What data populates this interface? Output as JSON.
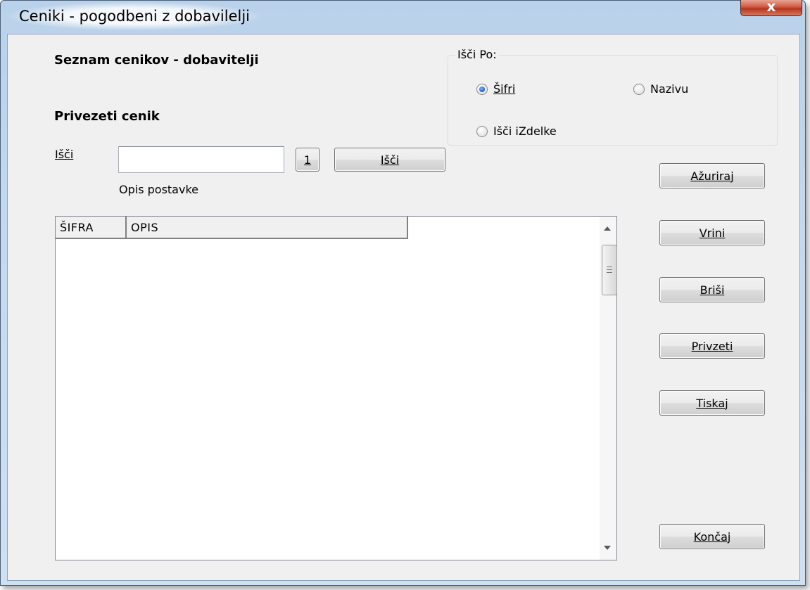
{
  "window": {
    "title": "Ceniki - pogodbeni z dobavilelji",
    "close_label": "x"
  },
  "form": {
    "heading": "Seznam cenikov - dobavitelji",
    "subheading": "Privezeti cenik",
    "search_label": "Išči",
    "search_value": "",
    "search_hint": "Opis postavke",
    "number_button_label": "1",
    "search_button_label": "Išči"
  },
  "search_by": {
    "title": "Išči Po:",
    "options": [
      {
        "label": "Šifri",
        "checked": true
      },
      {
        "label": "Nazivu",
        "checked": false
      },
      {
        "label": "Išči iZdelke",
        "checked": false
      }
    ]
  },
  "grid": {
    "columns": [
      "ŠIFRA",
      "OPIS"
    ],
    "rows": []
  },
  "buttons": {
    "update": "Ažuriraj",
    "insert": "Vrini",
    "delete": "Briši",
    "adopt": "Privzeti",
    "print": "Tiskaj",
    "finish": "Končaj"
  },
  "colors": {
    "window_frame": "#b9d1ea",
    "dialog_background": "#f0f0f0",
    "selected_radio": "#1c5ed1"
  }
}
